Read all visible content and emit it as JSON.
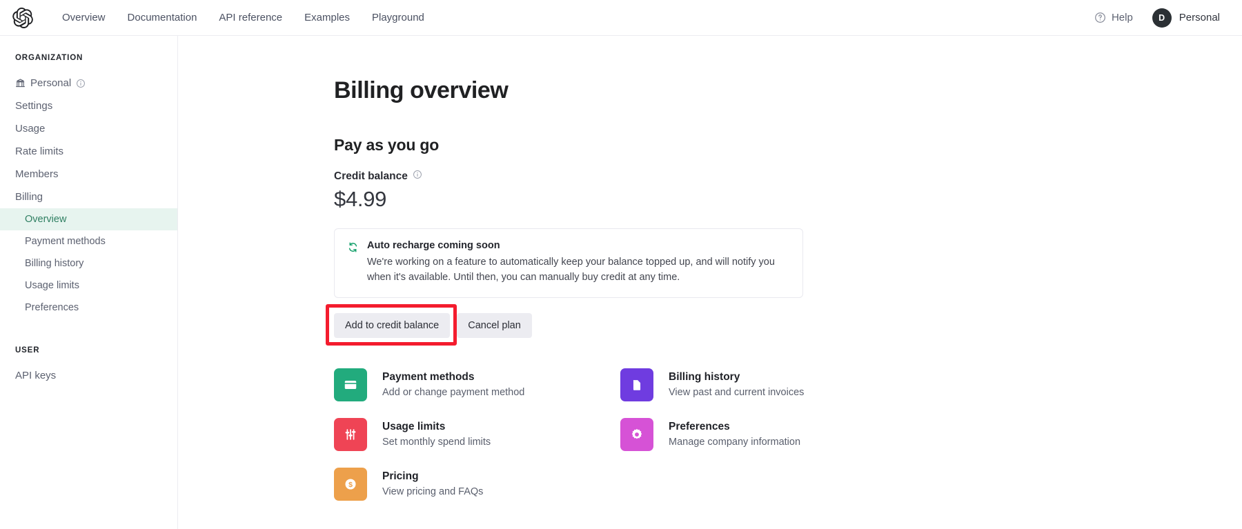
{
  "topbar": {
    "logo_icon": "openai-logo-icon",
    "nav": [
      {
        "label": "Overview"
      },
      {
        "label": "Documentation"
      },
      {
        "label": "API reference"
      },
      {
        "label": "Examples"
      },
      {
        "label": "Playground"
      }
    ],
    "help": {
      "label": "Help",
      "icon": "question-circle-icon"
    },
    "account": {
      "avatar_initial": "D",
      "name": "Personal",
      "avatar_color": "#2b3034"
    }
  },
  "sidebar": {
    "org_label": "ORGANIZATION",
    "user_label": "USER",
    "org_items": [
      {
        "label": "Personal",
        "icon": "bank-icon",
        "info_icon": "info-circle-icon",
        "active": false
      },
      {
        "label": "Settings",
        "active": false
      },
      {
        "label": "Usage",
        "active": false
      },
      {
        "label": "Rate limits",
        "active": false
      },
      {
        "label": "Members",
        "active": false
      },
      {
        "label": "Billing",
        "active": false
      }
    ],
    "billing_subitems": [
      {
        "label": "Overview",
        "active": true
      },
      {
        "label": "Payment methods",
        "active": false
      },
      {
        "label": "Billing history",
        "active": false
      },
      {
        "label": "Usage limits",
        "active": false
      },
      {
        "label": "Preferences",
        "active": false
      }
    ],
    "user_items": [
      {
        "label": "API keys",
        "active": false
      }
    ],
    "active_bg": "#e7f4ef",
    "active_text": "#2f7f62"
  },
  "main": {
    "page_title": "Billing overview",
    "plan_title": "Pay as you go",
    "credit_balance_label": "Credit balance",
    "credit_balance_info_icon": "info-circle-icon",
    "credit_balance_amount": "$4.99",
    "notice": {
      "icon": "refresh-circular-arrows-icon",
      "icon_color": "#14a06b",
      "title": "Auto recharge coming soon",
      "body": "We're working on a feature to automatically keep your balance topped up, and will notify you when it's available. Until then, you can manually buy credit at any time."
    },
    "buttons": [
      {
        "label": "Add to credit balance",
        "highlighted": true
      },
      {
        "label": "Cancel plan",
        "highlighted": false
      }
    ],
    "annotation_color": "#f41c2e",
    "cards": [
      {
        "title": "Payment methods",
        "subtitle": "Add or change payment method",
        "icon": "credit-card-icon",
        "color": "#22ab7d"
      },
      {
        "title": "Billing history",
        "subtitle": "View past and current invoices",
        "icon": "document-icon",
        "color": "#6f3ce0"
      },
      {
        "title": "Usage limits",
        "subtitle": "Set monthly spend limits",
        "icon": "sliders-icon",
        "color": "#ef4455"
      },
      {
        "title": "Preferences",
        "subtitle": "Manage company information",
        "icon": "gear-icon",
        "color": "#d652d6"
      },
      {
        "title": "Pricing",
        "subtitle": "View pricing and FAQs",
        "icon": "dollar-coin-icon",
        "color": "#eda04b"
      }
    ]
  }
}
